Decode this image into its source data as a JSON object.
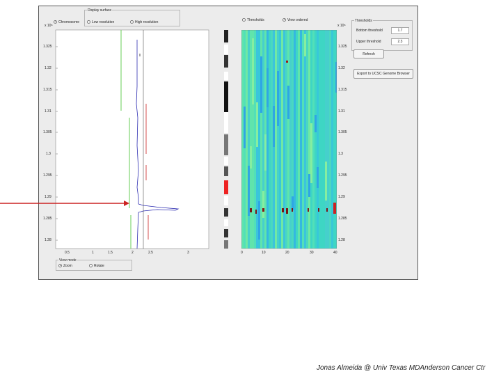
{
  "left_panel": {
    "display_box": {
      "title": "Display surface",
      "options": [
        {
          "label": "Chromosome",
          "selected": true
        },
        {
          "label": "Low resolution",
          "selected": false
        },
        {
          "label": "High resolution",
          "selected": false
        }
      ]
    },
    "plot": {
      "exponent": "x 10⁸",
      "y_ticks": [
        "1.325",
        "1.32",
        "1.315",
        "1.31",
        "1.305",
        "1.3",
        "1.295",
        "1.29",
        "1.285",
        "1.28"
      ],
      "x_ticks": [
        "0.5",
        "1",
        "1.5",
        "2",
        "2.5",
        "3"
      ]
    },
    "view_mode": {
      "title": "View mode",
      "options": [
        {
          "label": "Zoom",
          "selected": true
        },
        {
          "label": "Rotate",
          "selected": false
        }
      ]
    }
  },
  "center_panel": {
    "options": [
      {
        "label": "Thresholds",
        "selected": false
      },
      {
        "label": "View ordered",
        "selected": true
      }
    ],
    "exponent": "x 10⁸",
    "y_ticks": [
      "1.325",
      "1.32",
      "1.315",
      "1.31",
      "1.305",
      "1.3",
      "1.295",
      "1.29",
      "1.285",
      "1.28"
    ],
    "x_ticks": [
      "0",
      "10",
      "20",
      "30",
      "40"
    ]
  },
  "thresholds": {
    "title": "Thresholds",
    "bottom_label": "Bottom threshold",
    "bottom_value": "1.7",
    "upper_label": "Upper threshold",
    "upper_value": "2.3",
    "refresh_label": "Refresh",
    "export_label": "Export to UCSC Genome Browser"
  },
  "colors": {
    "arrow": "#cc2222",
    "green_trace": "#66cc55",
    "blue_trace": "#2a2ab0",
    "red_trace": "#cc2222",
    "heatmap_base": "#40d8c0"
  },
  "footer": "Jonas Almeida @ Univ Texas MDAnderson Cancer Ctr"
}
